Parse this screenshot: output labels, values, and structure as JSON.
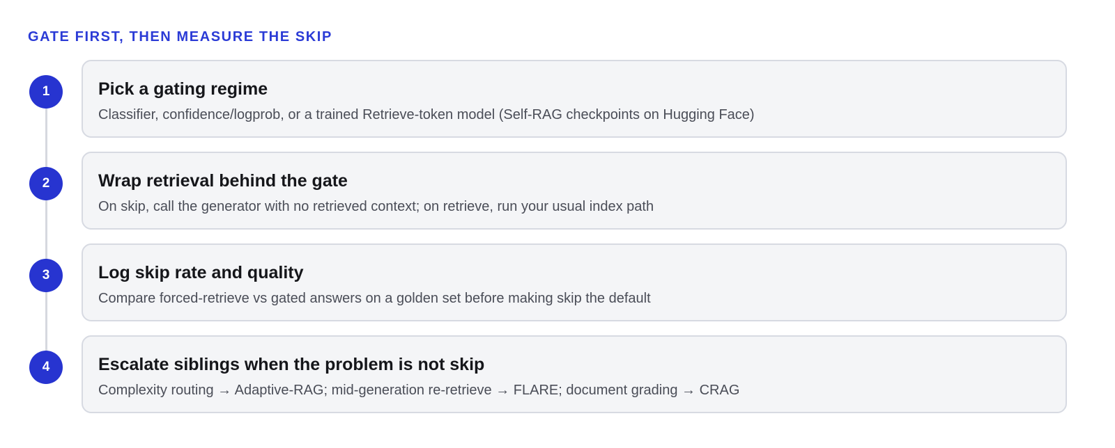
{
  "title": "GATE FIRST, THEN MEASURE THE SKIP",
  "colors": {
    "accent": "#2734d0",
    "card_background": "#f4f5f7",
    "card_border": "#d7dae2",
    "connector": "#d6d8df"
  },
  "steps": [
    {
      "number": "1",
      "heading": "Pick a gating regime",
      "description": "Classifier, confidence/logprob, or a trained Retrieve-token model (Self-RAG checkpoints on Hugging Face)"
    },
    {
      "number": "2",
      "heading": "Wrap retrieval behind the gate",
      "description": "On skip, call the generator with no retrieved context; on retrieve, run your usual index path"
    },
    {
      "number": "3",
      "heading": "Log skip rate and quality",
      "description": "Compare forced-retrieve vs gated answers on a golden set before making skip the default"
    },
    {
      "number": "4",
      "heading": "Escalate siblings when the problem is not skip",
      "description": "Complexity routing → Adaptive-RAG; mid-generation re-retrieve → FLARE; document grading → CRAG"
    }
  ]
}
